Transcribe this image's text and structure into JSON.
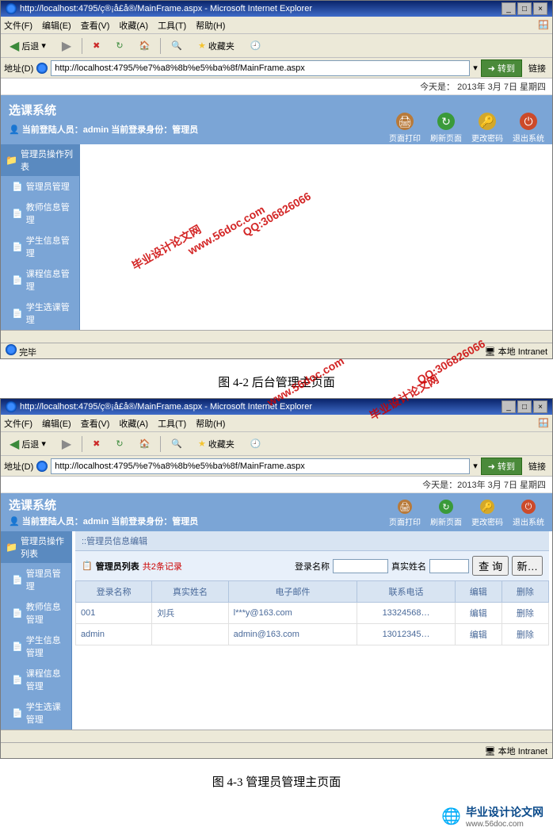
{
  "browser1": {
    "title": "http://localhost:4795/ç®¡å£å®/MainFrame.aspx - Microsoft Internet Explorer",
    "menu": [
      "文件(F)",
      "编辑(E)",
      "查看(V)",
      "收藏(A)",
      "工具(T)",
      "帮助(H)"
    ],
    "toolbar": {
      "back": "后退",
      "fav": "收藏夹"
    },
    "addr_label": "地址(D)",
    "addr_value": "http://localhost:4795/%e7%a8%8b%e5%ba%8f/MainFrame.aspx",
    "go": "转到",
    "links": "链接",
    "status": "完毕",
    "zone": "本地 Intranet"
  },
  "app": {
    "date_label": "今天是：",
    "date_value": "2013年 3月 7日 星期四",
    "sys_title": "选课系统",
    "login_prefix": "当前登陆人员：",
    "login_user": "admin",
    "login_role_prefix": " 当前登录身份：",
    "login_role": "管理员",
    "actions": [
      {
        "label": "页面打印",
        "color": "#b87a3a"
      },
      {
        "label": "刷新页面",
        "color": "#3a9a3a"
      },
      {
        "label": "更改密码",
        "color": "#d4a82a"
      },
      {
        "label": "退出系统",
        "color": "#cc4a2a"
      }
    ],
    "sidebar_head": "管理员操作列表",
    "sidebar": [
      "管理员管理",
      "教师信息管理",
      "学生信息管理",
      "课程信息管理",
      "学生选课管理"
    ]
  },
  "caption1": "图 4-2  后台管理主页面",
  "caption2": "图 4-3  管理员管理主页面",
  "panel": {
    "title": "::管理员信息编辑",
    "list_label": "管理员列表",
    "count": "共2条记录",
    "search_name_label": "登录名称",
    "search_real_label": "真实姓名",
    "query_btn": "查 询",
    "new_btn": "新…",
    "cols": [
      "登录名称",
      "真实姓名",
      "电子邮件",
      "联系电话",
      "编辑",
      "删除"
    ],
    "rows": [
      {
        "login": "001",
        "name": "刘兵",
        "email": "l***y@163.com",
        "phone": "13324568…",
        "edit": "编辑",
        "del": "删除"
      },
      {
        "login": "admin",
        "name": "",
        "email": "admin@163.com",
        "phone": "13012345…",
        "edit": "编辑",
        "del": "删除"
      }
    ]
  },
  "watermarks": {
    "wm1": "毕业设计论文网",
    "wm2": "www.56doc.com",
    "wm3": "QQ:306826066"
  },
  "footer_logo": "毕业设计论文网",
  "footer_url": "www.56doc.com"
}
